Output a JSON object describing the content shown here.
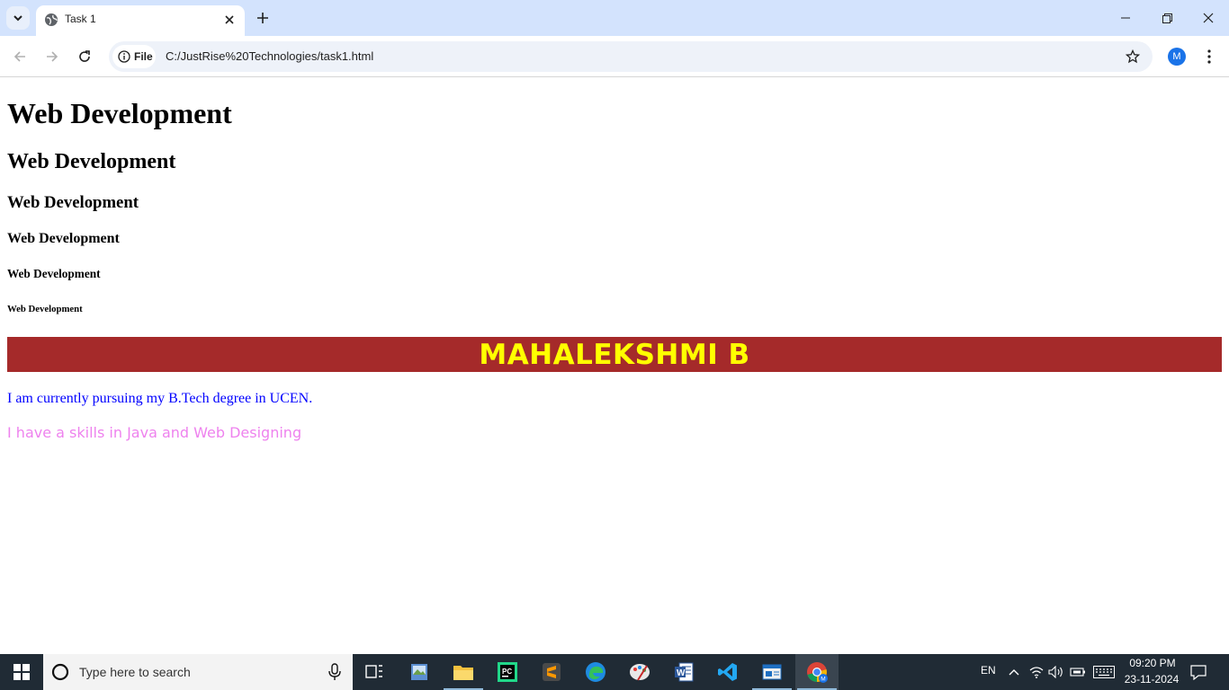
{
  "browser": {
    "tab": {
      "title": "Task 1"
    },
    "address_chip": "File",
    "url": "C:/JustRise%20Technologies/task1.html",
    "profile_initial": "M"
  },
  "page": {
    "h1": "Web Development",
    "h2": "Web Development",
    "h3": "Web Development",
    "h4": "Web Development",
    "h5": "Web Development",
    "h6": "Web Development",
    "banner": "MAHALEKSHMI B",
    "paragraph1": "I am currently pursuing my B.Tech degree in UCEN.",
    "paragraph2": "I have a skills in Java and Web Designing"
  },
  "colors": {
    "banner_bg": "#a52a2a",
    "banner_text": "#ffff00",
    "paragraph1": "#0000ff",
    "paragraph2": "#ee82ee"
  },
  "taskbar": {
    "search_placeholder": "Type here to search",
    "apps": [
      "task-view-icon",
      "photos-icon",
      "file-explorer-icon",
      "pycharm-icon",
      "sublime-text-icon",
      "edge-icon",
      "paint-icon",
      "word-icon",
      "vscode-icon",
      "app-icon",
      "chrome-icon"
    ],
    "language": "EN",
    "time": "09:20 PM",
    "date": "23-11-2024"
  }
}
